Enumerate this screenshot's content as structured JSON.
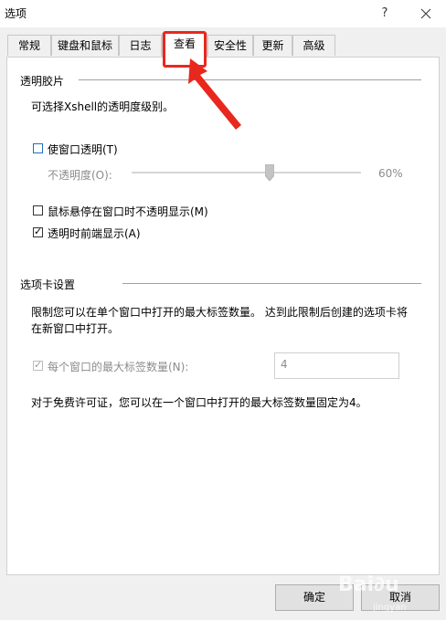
{
  "window": {
    "title": "选项",
    "help_glyph": "?"
  },
  "tabs": [
    {
      "label": "常规"
    },
    {
      "label": "键盘和鼠标"
    },
    {
      "label": "日志"
    },
    {
      "label": "查看",
      "active": true
    },
    {
      "label": "安全性"
    },
    {
      "label": "更新"
    },
    {
      "label": "高级"
    }
  ],
  "transparency": {
    "group_title": "透明胶片",
    "description": "可选择Xshell的透明度级别。",
    "enable_label": "使窗口透明(T)",
    "opacity_label": "不透明度(O):",
    "opacity_value": "60%",
    "opacity_fraction": 0.6,
    "hover_opaque_label": "鼠标悬停在窗口时不透明显示(M)",
    "front_label": "透明时前端显示(A)",
    "front_checked": true
  },
  "tab_settings": {
    "group_title": "选项卡设置",
    "description_line1": "限制您可以在单个窗口中打开的最大标签数量。 达到此限制后创建的选项卡将",
    "description_line2": "在新窗口中打开。",
    "max_tabs_label": "每个窗口的最大标签数量(N):",
    "max_tabs_value": "4",
    "note": "对于免费许可证，您可以在一个窗口中打开的最大标签数量固定为4。"
  },
  "buttons": {
    "ok": "确定",
    "cancel": "取消"
  },
  "watermark": {
    "text": "Bai∂u",
    "sub": "jingyan"
  },
  "colors": {
    "annotation": "#e8281e",
    "checkbox_blue": "#1e6fc4"
  }
}
